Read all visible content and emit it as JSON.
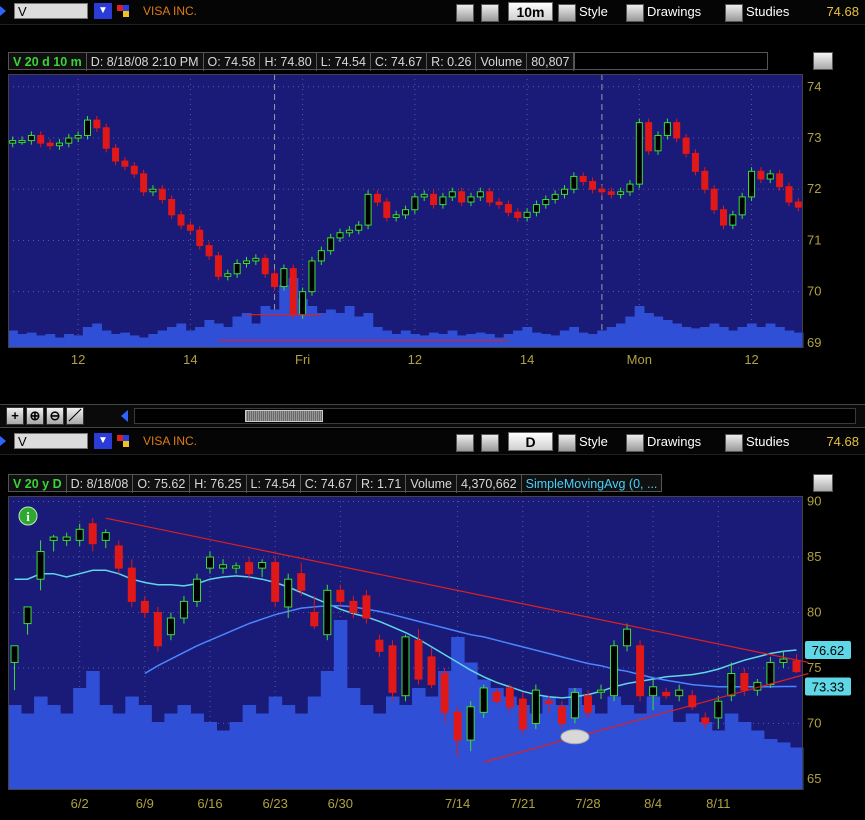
{
  "top_bar": {
    "symbol": "V",
    "company": "VISA INC.",
    "timeframe": "10m",
    "style_label": "Style",
    "drawings_label": "Drawings",
    "studies_label": "Studies",
    "last_price": "74.68"
  },
  "top_header": {
    "symbol_info": "V 20 d 10 m",
    "date": "D: 8/18/08 2:10 PM",
    "open": "O: 74.58",
    "high": "H: 74.80",
    "low": "L: 74.54",
    "close": "C: 74.67",
    "range": "R: 0.26",
    "volume_label": "Volume",
    "volume": "80,807"
  },
  "bottom_bar": {
    "symbol": "V",
    "company": "VISA INC.",
    "timeframe": "D",
    "style_label": "Style",
    "drawings_label": "Drawings",
    "studies_label": "Studies",
    "last_price": "74.68"
  },
  "bottom_header": {
    "symbol_info": "V 20 y D",
    "date": "D: 8/18/08",
    "open": "O: 75.62",
    "high": "H: 76.25",
    "low": "L: 74.54",
    "close": "C: 74.67",
    "range": "R: 1.71",
    "volume_label": "Volume",
    "volume": "4,370,662",
    "study": "SimpleMovingAvg (0, ..."
  },
  "colors": {
    "background": "#000000",
    "plot_bg": "#1a1a78",
    "up": "#3ddc3d",
    "down": "#e01818",
    "volume": "#2e4fd6",
    "ma_cyan": "#5fd7e6",
    "ma_blue": "#4a86ff",
    "trendline": "#e02020",
    "axis_text": "#b0a040"
  },
  "chart_data": [
    {
      "type": "candlestick",
      "title": "V 20 d 10 m",
      "x_tick_labels": [
        "12",
        "14",
        "Fri",
        "12",
        "14",
        "Mon",
        "12"
      ],
      "y_ticks": [
        69,
        70,
        71,
        72,
        73,
        74
      ],
      "ylim": [
        68.9,
        74.25
      ],
      "grid": true,
      "close_series": [
        72.95,
        72.95,
        73.05,
        72.9,
        72.85,
        72.9,
        73.0,
        73.05,
        73.35,
        73.2,
        72.8,
        72.55,
        72.45,
        72.3,
        71.95,
        72.0,
        71.8,
        71.5,
        71.3,
        71.2,
        70.9,
        70.7,
        70.3,
        70.35,
        70.55,
        70.6,
        70.65,
        70.35,
        70.1,
        70.45,
        69.55,
        70.0,
        70.6,
        70.8,
        71.05,
        71.15,
        71.2,
        71.3,
        71.9,
        71.75,
        71.45,
        71.5,
        71.6,
        71.85,
        71.9,
        71.7,
        71.85,
        71.95,
        71.75,
        71.85,
        71.95,
        71.75,
        71.7,
        71.55,
        71.45,
        71.55,
        71.7,
        71.8,
        71.9,
        72.0,
        72.25,
        72.15,
        72.0,
        71.95,
        71.9,
        71.95,
        72.1,
        73.3,
        72.75,
        73.05,
        73.3,
        73.0,
        72.7,
        72.35,
        72.0,
        71.6,
        71.3,
        71.5,
        71.85,
        72.35,
        72.2,
        72.3,
        72.05,
        71.75,
        71.65
      ],
      "volume_relative": [
        0.25,
        0.2,
        0.22,
        0.18,
        0.2,
        0.15,
        0.2,
        0.18,
        0.3,
        0.35,
        0.25,
        0.2,
        0.22,
        0.18,
        0.15,
        0.2,
        0.25,
        0.3,
        0.35,
        0.25,
        0.3,
        0.4,
        0.35,
        0.3,
        0.45,
        0.5,
        0.35,
        0.6,
        0.55,
        0.9,
        1.0,
        0.7,
        0.6,
        0.5,
        0.55,
        0.5,
        0.6,
        0.45,
        0.5,
        0.3,
        0.25,
        0.2,
        0.25,
        0.2,
        0.18,
        0.22,
        0.2,
        0.25,
        0.18,
        0.2,
        0.22,
        0.2,
        0.15,
        0.2,
        0.25,
        0.3,
        0.22,
        0.2,
        0.18,
        0.25,
        0.3,
        0.22,
        0.2,
        0.25,
        0.3,
        0.35,
        0.45,
        0.6,
        0.5,
        0.45,
        0.4,
        0.35,
        0.3,
        0.28,
        0.3,
        0.35,
        0.3,
        0.25,
        0.3,
        0.35,
        0.3,
        0.35,
        0.3,
        0.25,
        0.22
      ],
      "horizontal_line_prices": [
        69.55,
        69.05
      ],
      "vertical_session_dividers_at_bar": [
        28,
        63
      ]
    },
    {
      "type": "candlestick",
      "title": "V 20 y D",
      "x_tick_labels": [
        "6/2",
        "6/9",
        "6/16",
        "6/23",
        "6/30",
        "7/14",
        "7/21",
        "7/28",
        "8/4",
        "8/11"
      ],
      "y_ticks": [
        65,
        70,
        75,
        80,
        85,
        90
      ],
      "ylim": [
        64,
        90.5
      ],
      "grid": true,
      "bars": [
        {
          "o": 75.5,
          "h": 77,
          "l": 73,
          "c": 77
        },
        {
          "o": 79,
          "h": 80.5,
          "l": 78,
          "c": 80.5
        },
        {
          "o": 83,
          "h": 86.5,
          "l": 82,
          "c": 85.5
        },
        {
          "o": 86.5,
          "h": 87,
          "l": 85.5,
          "c": 86.8
        },
        {
          "o": 86.5,
          "h": 87.2,
          "l": 86,
          "c": 86.8
        },
        {
          "o": 86.5,
          "h": 88,
          "l": 86,
          "c": 87.5
        },
        {
          "o": 88,
          "h": 88.5,
          "l": 85.5,
          "c": 86.2
        },
        {
          "o": 86.5,
          "h": 87.5,
          "l": 85.8,
          "c": 87.2
        },
        {
          "o": 86,
          "h": 86.5,
          "l": 83.5,
          "c": 84
        },
        {
          "o": 84,
          "h": 84.8,
          "l": 80.5,
          "c": 81
        },
        {
          "o": 81,
          "h": 81.5,
          "l": 79.5,
          "c": 80
        },
        {
          "o": 80,
          "h": 80.5,
          "l": 76.5,
          "c": 77
        },
        {
          "o": 78,
          "h": 80,
          "l": 77.5,
          "c": 79.5
        },
        {
          "o": 79.5,
          "h": 81.5,
          "l": 79,
          "c": 81
        },
        {
          "o": 81,
          "h": 83.5,
          "l": 80.5,
          "c": 83
        },
        {
          "o": 84,
          "h": 85.5,
          "l": 83.5,
          "c": 85
        },
        {
          "o": 84,
          "h": 84.8,
          "l": 83.5,
          "c": 84.3
        },
        {
          "o": 84,
          "h": 84.5,
          "l": 83.5,
          "c": 84.2
        },
        {
          "o": 84.5,
          "h": 85,
          "l": 83,
          "c": 83.5
        },
        {
          "o": 84,
          "h": 84.8,
          "l": 83.2,
          "c": 84.5
        },
        {
          "o": 84.5,
          "h": 85,
          "l": 80.5,
          "c": 81
        },
        {
          "o": 80.5,
          "h": 83.5,
          "l": 79.5,
          "c": 83
        },
        {
          "o": 83.5,
          "h": 84.5,
          "l": 81.5,
          "c": 82
        },
        {
          "o": 80,
          "h": 81.5,
          "l": 78.5,
          "c": 78.8
        },
        {
          "o": 78,
          "h": 82.5,
          "l": 77.5,
          "c": 82
        },
        {
          "o": 82,
          "h": 82.5,
          "l": 80.5,
          "c": 81
        },
        {
          "o": 81,
          "h": 81.5,
          "l": 79.5,
          "c": 80
        },
        {
          "o": 81.5,
          "h": 82,
          "l": 79,
          "c": 79.5
        },
        {
          "o": 77.5,
          "h": 78,
          "l": 76,
          "c": 76.5
        },
        {
          "o": 77,
          "h": 77.5,
          "l": 72,
          "c": 72.8
        },
        {
          "o": 72.5,
          "h": 78,
          "l": 72,
          "c": 77.8
        },
        {
          "o": 77.5,
          "h": 78.5,
          "l": 73.5,
          "c": 74
        },
        {
          "o": 76,
          "h": 76.8,
          "l": 73.2,
          "c": 73.5
        },
        {
          "o": 74.5,
          "h": 75,
          "l": 70,
          "c": 71
        },
        {
          "o": 71,
          "h": 71.5,
          "l": 67,
          "c": 68.5
        },
        {
          "o": 68.5,
          "h": 72,
          "l": 67.5,
          "c": 71.5
        },
        {
          "o": 71,
          "h": 73.5,
          "l": 70.5,
          "c": 73.2
        },
        {
          "o": 72.8,
          "h": 73.2,
          "l": 71.8,
          "c": 72
        },
        {
          "o": 73.2,
          "h": 73.5,
          "l": 71,
          "c": 71.5
        },
        {
          "o": 72.2,
          "h": 72.8,
          "l": 69,
          "c": 69.5
        },
        {
          "o": 70,
          "h": 73.5,
          "l": 69.5,
          "c": 73
        },
        {
          "o": 72,
          "h": 72.5,
          "l": 71,
          "c": 71.8
        },
        {
          "o": 71.5,
          "h": 72,
          "l": 69.5,
          "c": 70
        },
        {
          "o": 70.5,
          "h": 73.2,
          "l": 70,
          "c": 72.8
        },
        {
          "o": 72.5,
          "h": 73,
          "l": 70.5,
          "c": 71
        },
        {
          "o": 73,
          "h": 73.5,
          "l": 72.2,
          "c": 73
        },
        {
          "o": 72.5,
          "h": 77.5,
          "l": 72,
          "c": 77
        },
        {
          "o": 77,
          "h": 79,
          "l": 76.5,
          "c": 78.5
        },
        {
          "o": 77,
          "h": 77.5,
          "l": 72,
          "c": 72.5
        },
        {
          "o": 72.5,
          "h": 74,
          "l": 71.2,
          "c": 73.3
        },
        {
          "o": 72.8,
          "h": 73.2,
          "l": 72.2,
          "c": 72.5
        },
        {
          "o": 72.5,
          "h": 73.5,
          "l": 72,
          "c": 73
        },
        {
          "o": 72.5,
          "h": 73,
          "l": 71.2,
          "c": 71.5
        },
        {
          "o": 70.5,
          "h": 71,
          "l": 69.5,
          "c": 70
        },
        {
          "o": 70.5,
          "h": 72.5,
          "l": 69.5,
          "c": 72
        },
        {
          "o": 72.5,
          "h": 75.5,
          "l": 72,
          "c": 74.5
        },
        {
          "o": 74.5,
          "h": 75,
          "l": 72.5,
          "c": 73
        },
        {
          "o": 73,
          "h": 74,
          "l": 72.5,
          "c": 73.7
        },
        {
          "o": 73.5,
          "h": 76,
          "l": 73.2,
          "c": 75.5
        },
        {
          "o": 75.5,
          "h": 76.5,
          "l": 75,
          "c": 75.8
        },
        {
          "o": 75.62,
          "h": 76.25,
          "l": 74.54,
          "c": 74.67
        }
      ],
      "volume_relative": [
        0.5,
        0.45,
        0.55,
        0.5,
        0.45,
        0.6,
        0.7,
        0.5,
        0.45,
        0.55,
        0.5,
        0.4,
        0.45,
        0.5,
        0.45,
        0.4,
        0.35,
        0.4,
        0.5,
        0.45,
        0.55,
        0.5,
        0.45,
        0.55,
        0.7,
        1.0,
        0.6,
        0.5,
        0.45,
        0.55,
        0.5,
        0.6,
        0.55,
        0.7,
        0.9,
        0.75,
        0.65,
        0.6,
        0.55,
        0.5,
        0.45,
        0.55,
        0.5,
        0.6,
        0.5,
        0.45,
        0.55,
        0.5,
        0.45,
        0.55,
        0.5,
        0.4,
        0.45,
        0.4,
        0.35,
        0.45,
        0.4,
        0.35,
        0.3,
        0.28,
        0.25
      ],
      "sma_cyan": [
        83,
        83,
        83.5,
        83.5,
        83.2,
        83.5,
        83.8,
        83.8,
        83.5,
        83,
        82.7,
        82.5,
        82.5,
        82.4,
        82.6,
        83,
        83.2,
        83.3,
        83.2,
        83,
        82.7,
        82.3,
        81.8,
        81.3,
        80.8,
        80.3,
        79.9,
        79.6,
        79.2,
        78.7,
        78.2,
        77.6,
        76.9,
        76.2,
        75.5,
        74.8,
        74.2,
        73.7,
        73.3,
        72.9,
        72.6,
        72.4,
        72.3,
        72.4,
        72.6,
        72.9,
        73.3,
        73.6,
        73.8,
        74,
        74.2,
        74.3,
        74.4,
        74.6,
        74.9,
        75.3,
        75.7,
        76,
        76.3,
        76.5,
        76.62
      ],
      "sma_blue": [
        null,
        null,
        null,
        null,
        null,
        null,
        null,
        null,
        null,
        null,
        74.5,
        75.2,
        75.8,
        76.4,
        77,
        77.5,
        78,
        78.5,
        79,
        79.4,
        79.8,
        80.1,
        80.4,
        80.5,
        80.6,
        80.6,
        80.5,
        80.3,
        80.1,
        79.8,
        79.5,
        79.2,
        78.9,
        78.6,
        78.3,
        78,
        77.8,
        77.5,
        77.2,
        76.9,
        76.6,
        76.3,
        76,
        75.7,
        75.4,
        75.2,
        74.9,
        74.7,
        74.4,
        74.1,
        73.9,
        73.7,
        73.5,
        73.4,
        73.3,
        73.3,
        73.3,
        73.3,
        73.3,
        73.33,
        73.33
      ],
      "price_labels": [
        "76.62",
        "73.33"
      ],
      "trendlines": [
        {
          "from": {
            "bar": 7,
            "price": 88.5
          },
          "to": {
            "bar": 60,
            "price": 75.5
          }
        },
        {
          "from": {
            "bar": 36,
            "price": 66.5
          },
          "to": {
            "bar": 60,
            "price": 74.5
          }
        }
      ]
    }
  ]
}
